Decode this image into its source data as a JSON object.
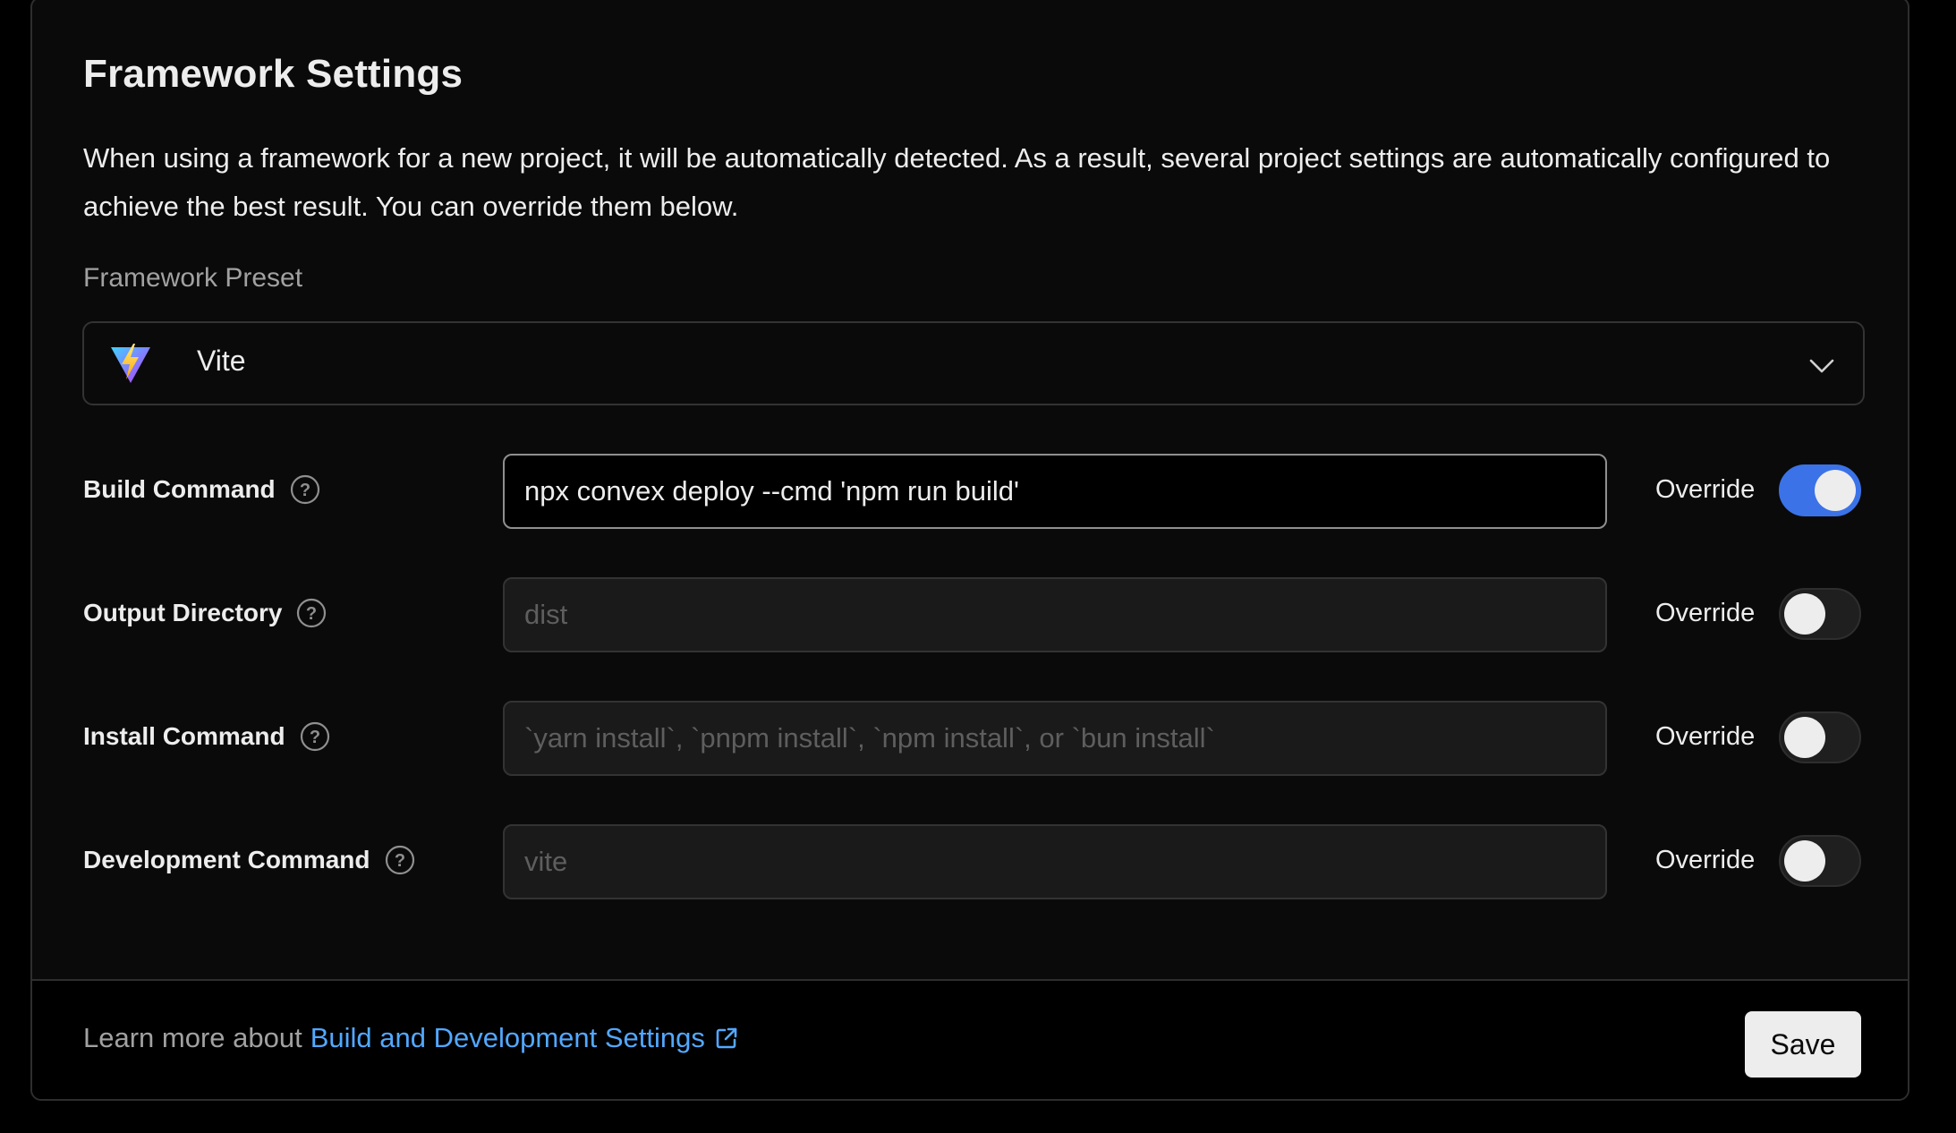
{
  "settings": {
    "title": "Framework Settings",
    "description": "When using a framework for a new project, it will be automatically detected. As a result, several project settings are automatically configured to achieve the best result. You can override them below.",
    "preset_label": "Framework Preset",
    "preset_value": "Vite",
    "preset_icon": "vite-logo-icon"
  },
  "rows": [
    {
      "label": "Build Command",
      "value": "npx convex deploy --cmd 'npm run build'",
      "placeholder": "",
      "override_label": "Override",
      "override_on": true
    },
    {
      "label": "Output Directory",
      "value": "",
      "placeholder": "dist",
      "override_label": "Override",
      "override_on": false
    },
    {
      "label": "Install Command",
      "value": "",
      "placeholder": "`yarn install`, `pnpm install`, `npm install`, or `bun install`",
      "override_label": "Override",
      "override_on": false
    },
    {
      "label": "Development Command",
      "value": "",
      "placeholder": "vite",
      "override_label": "Override",
      "override_on": false
    }
  ],
  "footer": {
    "learn_more_prefix": "Learn more about",
    "link_text": "Build and Development Settings",
    "save_label": "Save"
  },
  "colors": {
    "accent": "#3b72e8",
    "link": "#52a8ff",
    "background": "#0a0a0a"
  }
}
